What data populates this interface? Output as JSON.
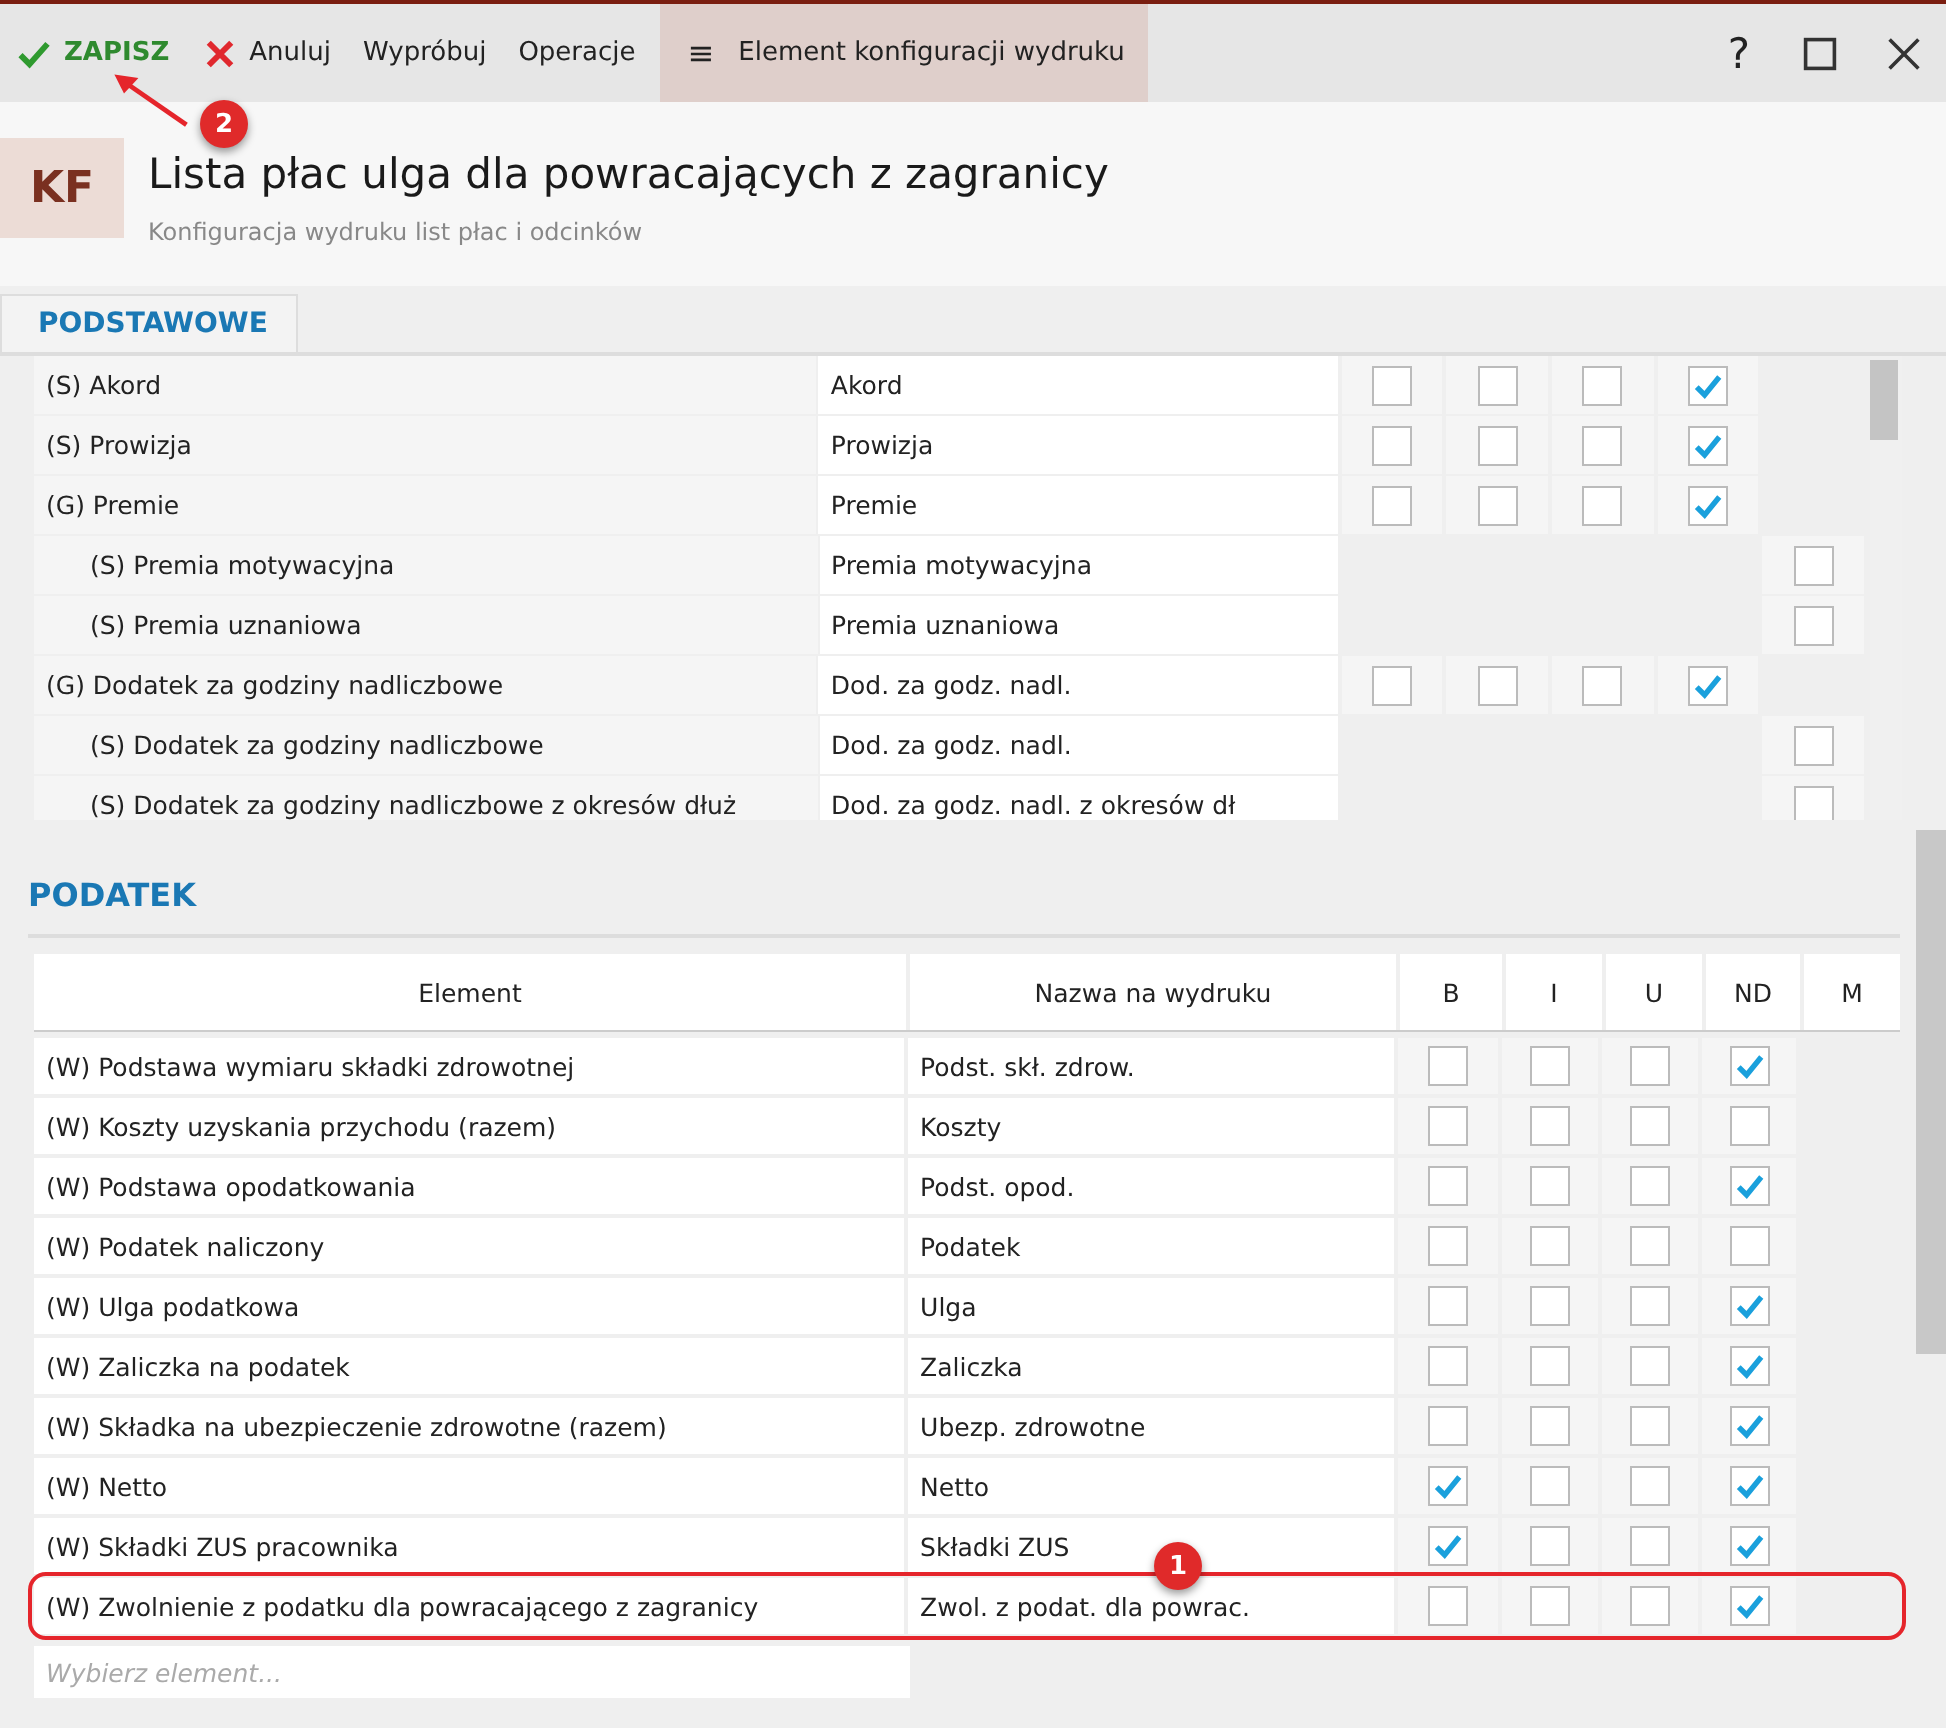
{
  "toolbar": {
    "save": "ZAPISZ",
    "cancel": "Anuluj",
    "try": "Wypróbuj",
    "operations": "Operacje",
    "menu_icon": "≡",
    "context": "Element konfiguracji wydruku",
    "help": "?"
  },
  "header": {
    "badge": "KF",
    "title": "Lista płac ulga dla powracających z zagranicy",
    "subtitle": "Konfiguracja wydruku list płac i odcinków"
  },
  "tabs": [
    {
      "label": "PODSTAWOWE",
      "selected": true
    }
  ],
  "top_rows": [
    {
      "element": "(S) Akord",
      "print": "Akord",
      "b": false,
      "i": false,
      "u": false,
      "nd": true
    },
    {
      "element": "(S) Prowizja",
      "print": "Prowizja",
      "b": false,
      "i": false,
      "u": false,
      "nd": true
    },
    {
      "element": "(G) Premie",
      "print": "Premie",
      "b": false,
      "i": false,
      "u": false,
      "nd": true,
      "children": [
        {
          "element": "(S) Premia motywacyjna",
          "print": "Premia motywacyjna",
          "m": false
        },
        {
          "element": "(S) Premia uznaniowa",
          "print": "Premia uznaniowa",
          "m": false
        }
      ]
    },
    {
      "element": "(G) Dodatek za godziny nadliczbowe",
      "print": "Dod. za godz. nadl.",
      "b": false,
      "i": false,
      "u": false,
      "nd": true,
      "children": [
        {
          "element": "(S) Dodatek za godziny nadliczbowe",
          "print": "Dod. za godz. nadl.",
          "m": false
        },
        {
          "element": "(S) Dodatek za godziny nadliczbowe z okresów dłuż",
          "print": "Dod. za godz. nadl. z okresów dł",
          "m": false
        }
      ]
    }
  ],
  "section": "PODATEK",
  "columns": [
    "Element",
    "Nazwa na wydruku",
    "B",
    "I",
    "U",
    "ND",
    "M"
  ],
  "rows": [
    {
      "element": "(W) Podstawa wymiaru składki zdrowotnej",
      "print": "Podst. skł. zdrow.",
      "b": false,
      "i": false,
      "u": false,
      "nd": true,
      "highlighted": false
    },
    {
      "element": "(W) Koszty uzyskania przychodu (razem)",
      "print": "Koszty",
      "b": false,
      "i": false,
      "u": false,
      "nd": false,
      "highlighted": false
    },
    {
      "element": "(W) Podstawa opodatkowania",
      "print": "Podst. opod.",
      "b": false,
      "i": false,
      "u": false,
      "nd": true,
      "highlighted": false
    },
    {
      "element": "(W) Podatek naliczony",
      "print": "Podatek",
      "b": false,
      "i": false,
      "u": false,
      "nd": false,
      "highlighted": false
    },
    {
      "element": "(W) Ulga podatkowa",
      "print": "Ulga",
      "b": false,
      "i": false,
      "u": false,
      "nd": true,
      "highlighted": false
    },
    {
      "element": "(W) Zaliczka na podatek",
      "print": "Zaliczka",
      "b": false,
      "i": false,
      "u": false,
      "nd": true,
      "highlighted": false
    },
    {
      "element": "(W) Składka na ubezpieczenie zdrowotne (razem)",
      "print": "Ubezp. zdrowotne",
      "b": false,
      "i": false,
      "u": false,
      "nd": true,
      "highlighted": false
    },
    {
      "element": "(W) Netto",
      "print": "Netto",
      "b": true,
      "i": false,
      "u": false,
      "nd": true,
      "highlighted": false
    },
    {
      "element": "(W) Składki ZUS pracownika",
      "print": "Składki ZUS",
      "b": true,
      "i": false,
      "u": false,
      "nd": true,
      "highlighted": false
    },
    {
      "element": "(W) Zwolnienie z podatku dla powracającego z zagranicy",
      "print": "Zwol. z podat. dla powrac.",
      "b": false,
      "i": false,
      "u": false,
      "nd": true,
      "highlighted": true
    }
  ],
  "add_placeholder": "Wybierz element...",
  "annotations": [
    {
      "label": "2"
    },
    {
      "label": "1"
    }
  ]
}
